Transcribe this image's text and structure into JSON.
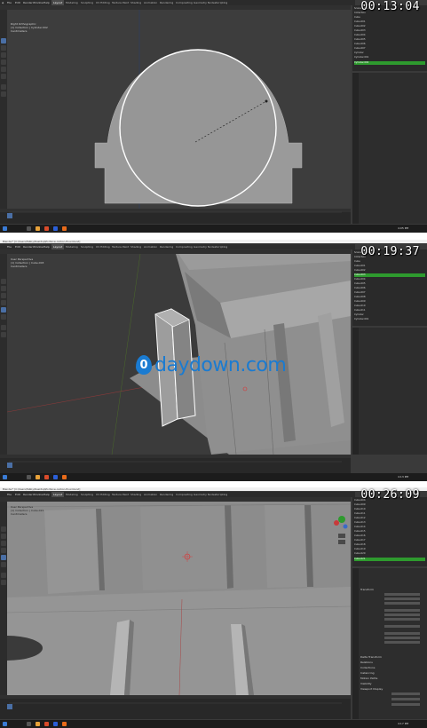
{
  "segments": [
    {
      "timestamp": "00:13:04",
      "menus": [
        "File",
        "Edit",
        "Render",
        "Window",
        "Help"
      ],
      "workspace_tabs": [
        "Layout",
        "Modeling",
        "Sculpting",
        "UV Editing",
        "Texture Paint",
        "Shading",
        "Animation",
        "Rendering",
        "Compositing",
        "Geometry Nodes",
        "Scripting"
      ],
      "viewport_info": [
        "Right Orthographic",
        "(1) Collection | Cylinder.002",
        "Centimeters"
      ],
      "outliner_items": [
        "Scene Collection",
        "Collection",
        "Cube",
        "Cube.001",
        "Cube.002",
        "Cube.003",
        "Cube.004",
        "Cube.005",
        "Cube.006",
        "Cube.007",
        "Cylinder",
        "Cylinder.001",
        "Cylinder.002"
      ],
      "selected_item": "Cylinder.002",
      "clock": "4:05 PM"
    },
    {
      "timestamp": "00:19:37",
      "title": "Blender* [C:\\Users\\Tabby\\Desktop\\Portal-w-carbon-fiour.blend]",
      "menus": [
        "File",
        "Edit",
        "Render",
        "Window",
        "Help"
      ],
      "workspace_tabs": [
        "Layout",
        "Modeling",
        "Sculpting",
        "UV Editing",
        "Texture Paint",
        "Shading",
        "Animation",
        "Rendering",
        "Compositing",
        "Geometry Nodes",
        "Scripting"
      ],
      "viewport_info": [
        "User Perspective",
        "(1) Collection | Cube.003",
        "Centimeters"
      ],
      "outliner_items": [
        "Scene Collection",
        "Collection",
        "Cube",
        "Cube.001",
        "Cube.002",
        "Cube.003",
        "Cube.004",
        "Cube.005",
        "Cube.006",
        "Cube.007",
        "Cube.008",
        "Cube.009",
        "Cube.010",
        "Cube.011",
        "Cylinder",
        "Cylinder.001"
      ],
      "selected_item": "Cube.003",
      "clock": "4:13 PM"
    },
    {
      "timestamp": "00:26:09",
      "title": "Blender* [C:\\Users\\Tabby\\Desktop\\Portal-w-carbon-fiour.blend]",
      "menus": [
        "File",
        "Edit",
        "Render",
        "Window",
        "Help"
      ],
      "workspace_tabs": [
        "Layout",
        "Modeling",
        "Sculpting",
        "UV Editing",
        "Texture Paint",
        "Shading",
        "Animation",
        "Rendering",
        "Compositing",
        "Geometry Nodes",
        "Scripting"
      ],
      "viewport_info": [
        "User Perspective",
        "(1) Collection | Cube.021",
        "Centimeters"
      ],
      "outliner_items": [
        "Cube.008",
        "Cube.009",
        "Cube.010",
        "Cube.011",
        "Cube.012",
        "Cube.013",
        "Cube.014",
        "Cube.015",
        "Cube.016",
        "Cube.017",
        "Cube.018",
        "Cube.019",
        "Cube.020",
        "Cube.021"
      ],
      "selected_item": "Cube.021",
      "props_sections": [
        "Transform",
        "Delta Transform",
        "Relations",
        "Collections",
        "Instancing",
        "Motion Paths",
        "Visibility",
        "Viewport Display"
      ],
      "clock": "4:17 PM"
    }
  ],
  "watermark": "daydown.com",
  "colors": {
    "selected": "#2e9a2e",
    "accent": "#4a6fa5",
    "watermark": "#1a7bd1"
  }
}
